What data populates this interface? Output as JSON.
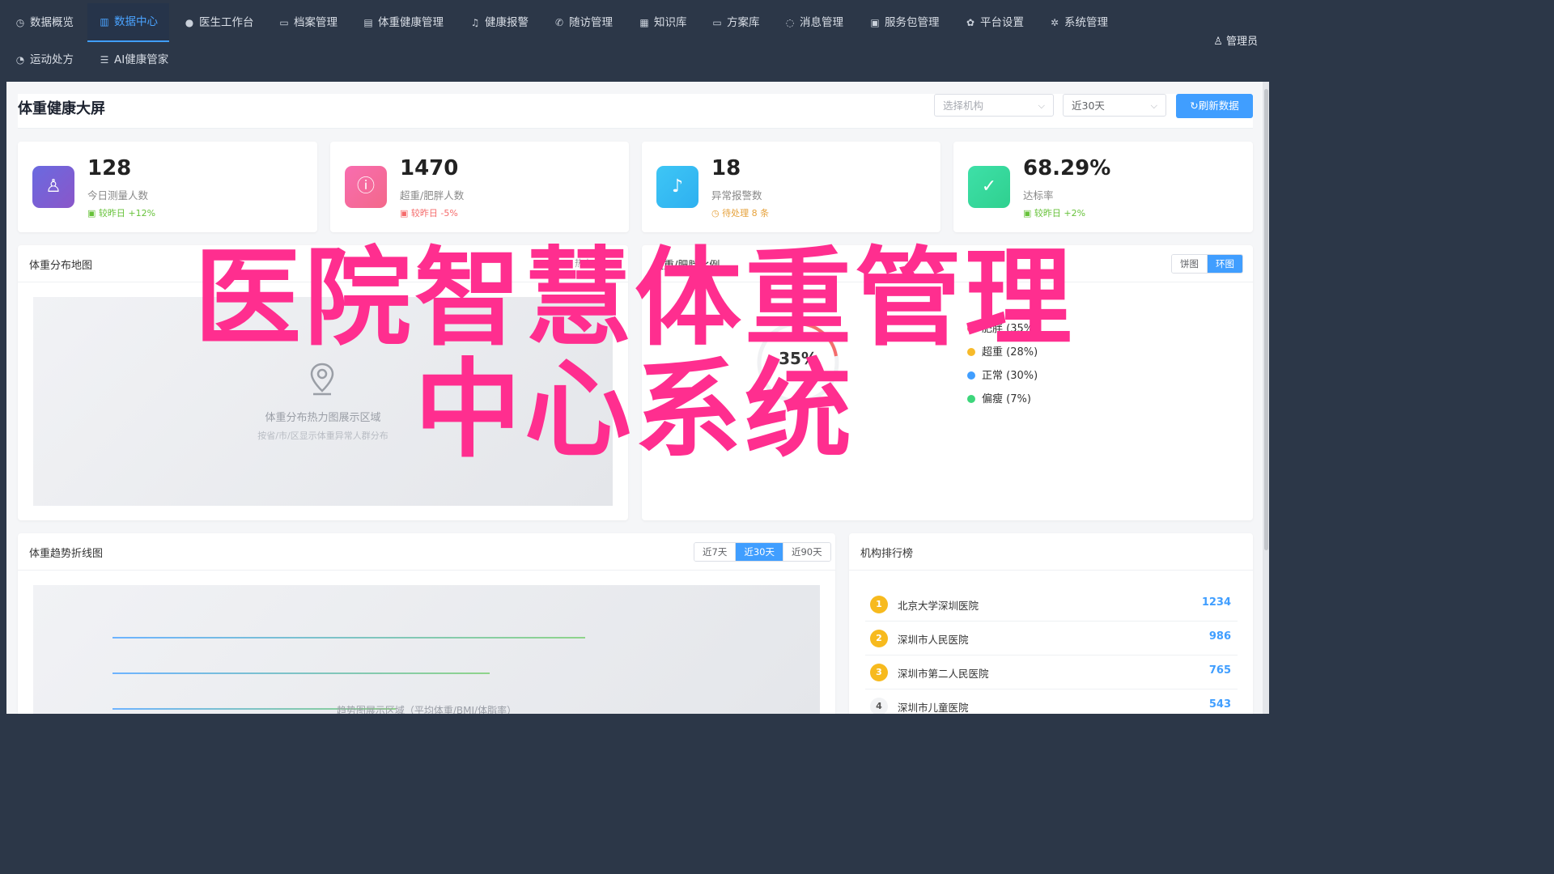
{
  "nav": {
    "row1": [
      {
        "icon": "◷",
        "label": "数据概览"
      },
      {
        "icon": "▥",
        "label": "数据中心",
        "active": true
      },
      {
        "icon": "●",
        "label": "医生工作台"
      },
      {
        "icon": "▭",
        "label": "档案管理"
      },
      {
        "icon": "▤",
        "label": "体重健康管理"
      },
      {
        "icon": "♫",
        "label": "健康报警"
      },
      {
        "icon": "✆",
        "label": "随访管理"
      },
      {
        "icon": "▦",
        "label": "知识库"
      },
      {
        "icon": "▭",
        "label": "方案库"
      },
      {
        "icon": "◌",
        "label": "消息管理"
      },
      {
        "icon": "▣",
        "label": "服务包管理"
      },
      {
        "icon": "✿",
        "label": "平台设置"
      },
      {
        "icon": "✲",
        "label": "系统管理"
      }
    ],
    "row2": [
      {
        "icon": "◔",
        "label": "运动处方"
      },
      {
        "icon": "☰",
        "label": "AI健康管家"
      }
    ],
    "user": "管理员"
  },
  "header": {
    "title": "体重健康大屏",
    "org_placeholder": "选择机构",
    "range_value": "近30天",
    "refresh_label": "刷新数据"
  },
  "stats": [
    {
      "value": "128",
      "label": "今日测量人数",
      "trend": "较昨日 +12%",
      "trend_color": "#67c23a",
      "color_from": "#6a6ae0",
      "color_to": "#8a56c9",
      "icon": "♙"
    },
    {
      "value": "1470",
      "label": "超重/肥胖人数",
      "trend": "较昨日 -5%",
      "trend_color": "#f56c6c",
      "color_from": "#f86db0",
      "color_to": "#f3688a",
      "icon": "ⓘ"
    },
    {
      "value": "18",
      "label": "异常报警数",
      "trend": "待处理 8 条",
      "trend_color": "#e6a23c",
      "color_from": "#3ec6f5",
      "color_to": "#2eb0f0",
      "icon": "♪"
    },
    {
      "value": "68.29%",
      "label": "达标率",
      "trend": "较昨日 +2%",
      "trend_color": "#67c23a",
      "color_from": "#3ee0a8",
      "color_to": "#2fd08f",
      "icon": "✓"
    }
  ],
  "map_panel": {
    "title": "体重分布地图",
    "tag": "热力",
    "placeholder_title": "体重分布热力图展示区域",
    "placeholder_sub": "按省/市/区显示体重异常人群分布"
  },
  "ratio_panel": {
    "title": "超重/肥胖比例",
    "toggle": [
      "饼图",
      "环图"
    ],
    "toggle_active": 1,
    "center_value": "35%",
    "center_label": "肥胖",
    "legend": [
      {
        "label": "肥胖 (35%)",
        "color": "#f56c6c"
      },
      {
        "label": "超重 (28%)",
        "color": "#f7ba2a"
      },
      {
        "label": "正常 (30%)",
        "color": "#409eff"
      },
      {
        "label": "偏瘦 (7%)",
        "color": "#3dd67b"
      }
    ]
  },
  "trend_panel": {
    "title": "体重趋势折线图",
    "ranges": [
      "近7天",
      "近30天",
      "近90天"
    ],
    "range_active": 1,
    "placeholder": "趋势图展示区域（平均体重/BMI/体脂率）"
  },
  "rank_panel": {
    "title": "机构排行榜",
    "rows": [
      {
        "rank": "1",
        "name": "北京大学深圳医院",
        "value": "1234"
      },
      {
        "rank": "2",
        "name": "深圳市人民医院",
        "value": "986"
      },
      {
        "rank": "3",
        "name": "深圳市第二人民医院",
        "value": "765"
      },
      {
        "rank": "4",
        "name": "深圳市儿童医院",
        "value": "543"
      }
    ]
  },
  "overlay": {
    "line1": "医院智慧体重管理",
    "line2": "中心系统"
  }
}
